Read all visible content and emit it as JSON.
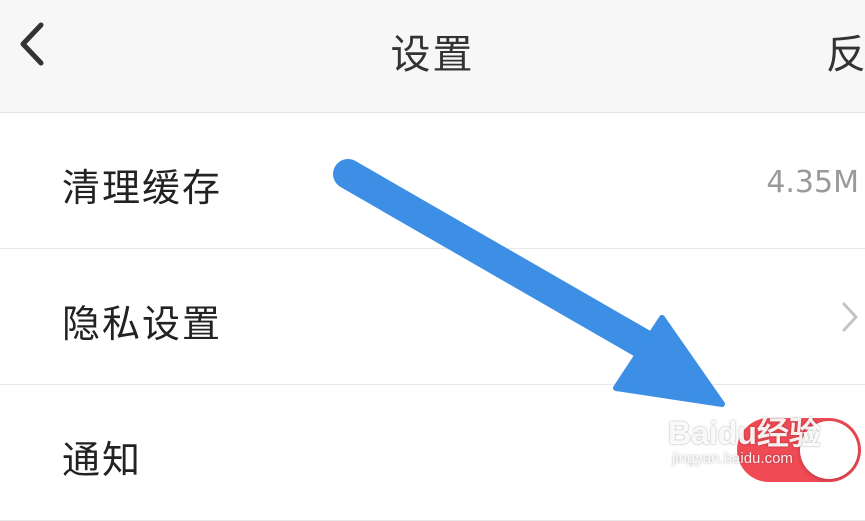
{
  "nav": {
    "title": "设置",
    "right_label": "反",
    "back_icon": "chevron-left-icon"
  },
  "settings": {
    "items": [
      {
        "label": "清理缓存",
        "value": "4.35M"
      },
      {
        "label": "隐私设置",
        "icon": "chevron-right-icon"
      },
      {
        "label": "通知",
        "toggle_on": true
      }
    ]
  },
  "overlay": {
    "arrow_color": "#3d8fe6",
    "watermark": {
      "brand": "Baidu经验",
      "url": "jingyan.baidu.com"
    }
  },
  "colors": {
    "toggle_on": "#f04a55",
    "accent_arrow": "#3d8fe6"
  }
}
